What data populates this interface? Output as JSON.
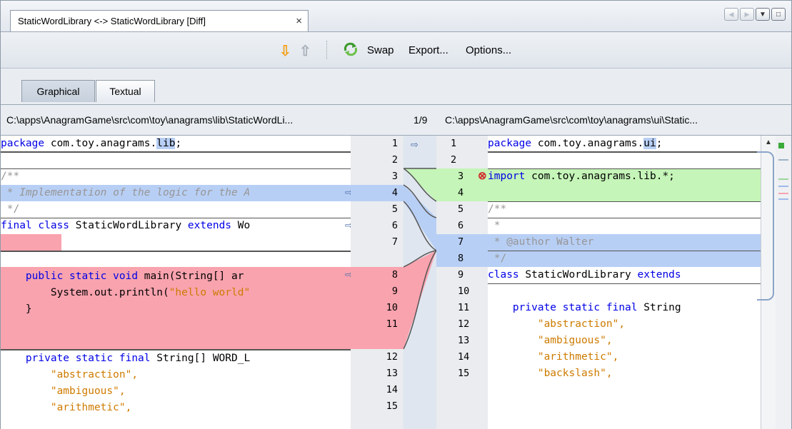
{
  "tab": {
    "title": "StaticWordLibrary <-> StaticWordLibrary [Diff]",
    "close": "×"
  },
  "window_buttons": [
    "◀",
    "▶",
    "▼",
    "□"
  ],
  "toolbar": {
    "next_diff": "⇩",
    "prev_diff": "⇧",
    "swap": "Swap",
    "export": "Export...",
    "options": "Options..."
  },
  "view_tabs": {
    "graphical": "Graphical",
    "textual": "Textual"
  },
  "paths": {
    "left": "C:\\apps\\AnagramGame\\src\\com\\toy\\anagrams\\lib\\StaticWordLi...",
    "counter": "1/9",
    "right": "C:\\apps\\AnagramGame\\src\\com\\toy\\anagrams\\ui\\Static..."
  },
  "left_numbers": [
    "1",
    "2",
    "3",
    "4",
    "5",
    "6",
    "7",
    "8",
    "9",
    "10",
    "11",
    "12",
    "13",
    "14",
    "15"
  ],
  "right_numbers": [
    "1",
    "2",
    "3",
    "4",
    "5",
    "6",
    "7",
    "8",
    "9",
    "10",
    "11",
    "12",
    "13",
    "14",
    "15"
  ],
  "left_code": {
    "l1a": "package",
    "l1b": " com.toy.anagrams.",
    "l1c": "lib",
    "l1d": ";",
    "l3": "/**",
    "l4": " * Implementation of the logic for the A",
    "l5": " */",
    "l6a": "final",
    "l6b": " ",
    "l6c": "class",
    "l6d": " StaticWordLibrary ",
    "l6e": "extends",
    "l6f": " Wo",
    "l8a": "    ",
    "l8b": "public static void",
    "l8c": " main(String[] ar",
    "l9a": "        System.out.println(",
    "l9b": "\"hello world\"",
    "l10": "    }",
    "l12a": "    ",
    "l12b": "private static final",
    "l12c": " String[] WORD_L",
    "l13": "        \"abstraction\",",
    "l14": "        \"ambiguous\",",
    "l15": "        \"arithmetic\","
  },
  "right_code": {
    "r1a": "package",
    "r1b": " com.toy.anagrams.",
    "r1c": "ui",
    "r1d": ";",
    "r3a": "import",
    "r3b": " com.toy.anagrams.lib.*;",
    "r5": "/**",
    "r6": " *",
    "r7": " * @author Walter",
    "r8": " */",
    "r9a": "class",
    "r9b": " StaticWordLibrary ",
    "r9c": "extends",
    "r11a": "    ",
    "r11b": "private static final",
    "r11c": " String",
    "r12": "        \"abstraction\",",
    "r13": "        \"ambiguous\",",
    "r14": "        \"arithmetic\",",
    "r15": "        \"backslash\","
  },
  "colors": {
    "added": "#c5f5b8",
    "changed": "#b8cff5",
    "removed": "#f9a3ae",
    "keyword": "#0000e6",
    "string": "#ce7b00"
  }
}
